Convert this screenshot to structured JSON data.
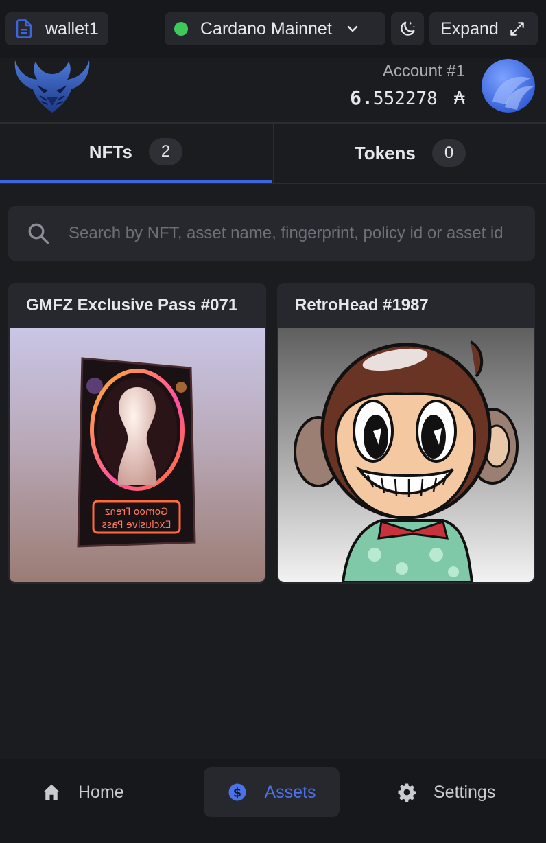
{
  "topbar": {
    "wallet_name": "wallet1",
    "network": "Cardano Mainnet",
    "network_status_color": "#3ec95a",
    "expand_label": "Expand"
  },
  "account": {
    "name": "Account #1",
    "balance_int": "6.",
    "balance_dec": "552278",
    "currency_symbol": "₳"
  },
  "tabs": [
    {
      "label": "NFTs",
      "count": "2",
      "active": true
    },
    {
      "label": "Tokens",
      "count": "0",
      "active": false
    }
  ],
  "search": {
    "placeholder": "Search by NFT, asset name, fingerprint, policy id or asset id"
  },
  "nfts": [
    {
      "title": "GMFZ Exclusive Pass #071",
      "card_text_line1": "Gomoo Frenz",
      "card_text_line2": "Exclusive Pass"
    },
    {
      "title": "RetroHead #1987"
    }
  ],
  "bottom_nav": {
    "home": "Home",
    "assets": "Assets",
    "settings": "Settings"
  },
  "colors": {
    "accent": "#3b66e0",
    "background": "#1b1c1f",
    "surface": "#26282d"
  },
  "icons": [
    "document-icon",
    "chevron-down-icon",
    "moon-stars-icon",
    "expand-arrows-icon",
    "search-icon",
    "home-icon",
    "dollar-coin-icon",
    "gear-icon"
  ]
}
